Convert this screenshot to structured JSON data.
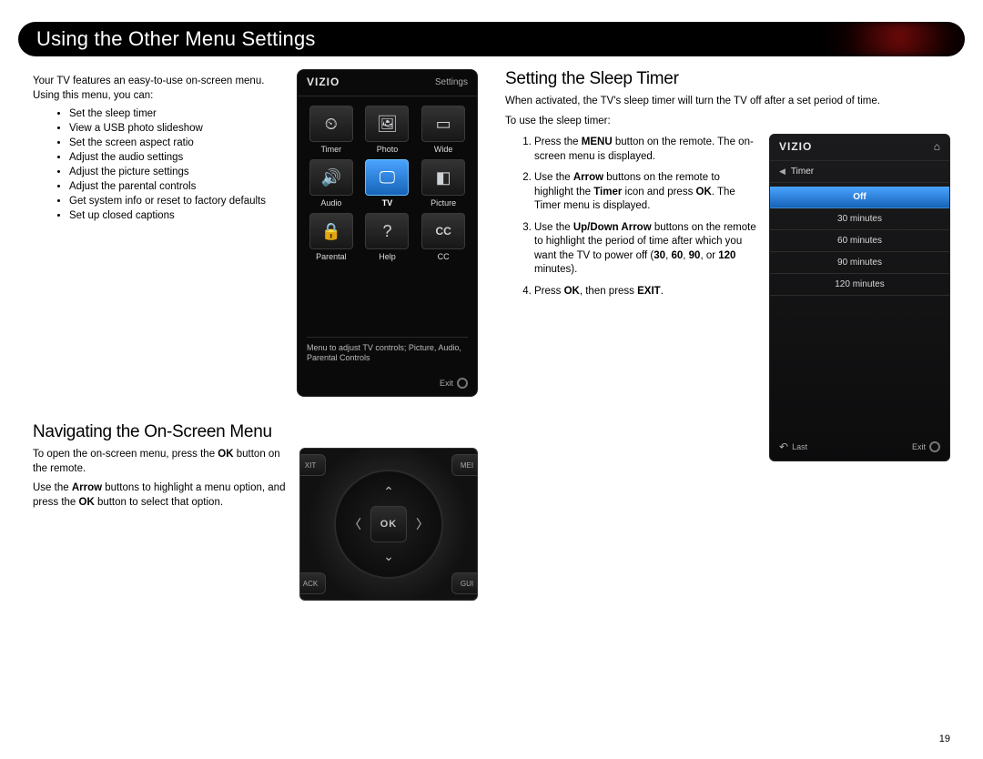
{
  "page_title": "Using the Other Menu Settings",
  "page_number": "19",
  "left": {
    "intro": "Your TV features an easy-to-use on-screen menu. Using this menu, you can:",
    "bullets": [
      "Set the sleep timer",
      "View a USB photo slideshow",
      "Set the screen aspect ratio",
      "Adjust the audio settings",
      "Adjust the picture settings",
      "Adjust the parental controls",
      "Get system info or reset to factory defaults",
      "Set up closed captions"
    ],
    "nav_heading": "Navigating the On-Screen Menu",
    "nav_p1_a": "To open the on-screen menu, press the ",
    "nav_p1_b": "OK",
    "nav_p1_c": " button on the remote.",
    "nav_p2_a": "Use the ",
    "nav_p2_b": "Arrow",
    "nav_p2_c": " buttons to highlight a menu option, and press the ",
    "nav_p2_d": "OK",
    "nav_p2_e": " button to select that option."
  },
  "menu1": {
    "logo": "VIZIO",
    "title": "Settings",
    "tiles": [
      {
        "label": "Timer",
        "glyph": "⏲",
        "sel": false
      },
      {
        "label": "Photo",
        "glyph": "🖼",
        "sel": false
      },
      {
        "label": "Wide",
        "glyph": "▭",
        "sel": false
      },
      {
        "label": "Audio",
        "glyph": "🔊",
        "sel": false
      },
      {
        "label": "TV",
        "glyph": "🖵",
        "sel": true
      },
      {
        "label": "Picture",
        "glyph": "◧",
        "sel": false
      },
      {
        "label": "Parental",
        "glyph": "🔒",
        "sel": false
      },
      {
        "label": "Help",
        "glyph": "?",
        "sel": false
      },
      {
        "label": "CC",
        "glyph": "CC",
        "sel": false
      }
    ],
    "desc": "Menu to adjust TV controls; Picture, Audio, Parental Controls",
    "exit": "Exit"
  },
  "remote": {
    "ok": "OK",
    "c_tl": "XIT",
    "c_tr": "MEI",
    "c_bl": "ACK",
    "c_br": "GUI"
  },
  "right": {
    "heading": "Setting the Sleep Timer",
    "intro": "When activated, the TV's sleep timer will turn the TV off after a set period of time.",
    "to_use": "To use the sleep timer:",
    "s1_a": "Press the ",
    "s1_b": "MENU",
    "s1_c": " button on the remote. The on-screen menu is displayed.",
    "s2_a": "Use the ",
    "s2_b": "Arrow",
    "s2_c": " buttons on the remote to highlight the ",
    "s2_d": "Timer",
    "s2_e": " icon and press ",
    "s2_f": "OK",
    "s2_g": ". The Timer menu is displayed.",
    "s3_a": "Use the ",
    "s3_b": "Up/Down Arrow",
    "s3_c": " buttons on the remote to highlight the period of time after which you want the TV to power off (",
    "s3_d": "30",
    "s3_e": ", ",
    "s3_f": "60",
    "s3_g": ", ",
    "s3_h": "90",
    "s3_i": ", or ",
    "s3_j": "120",
    "s3_k": " minutes).",
    "s4_a": "Press ",
    "s4_b": "OK",
    "s4_c": ", then press ",
    "s4_d": "EXIT",
    "s4_e": "."
  },
  "menu2": {
    "logo": "VIZIO",
    "crumb": "Timer",
    "items": [
      {
        "label": "Off",
        "sel": true
      },
      {
        "label": "30 minutes",
        "sel": false
      },
      {
        "label": "60 minutes",
        "sel": false
      },
      {
        "label": "90 minutes",
        "sel": false
      },
      {
        "label": "120 minutes",
        "sel": false
      }
    ],
    "last": "Last",
    "exit": "Exit"
  }
}
